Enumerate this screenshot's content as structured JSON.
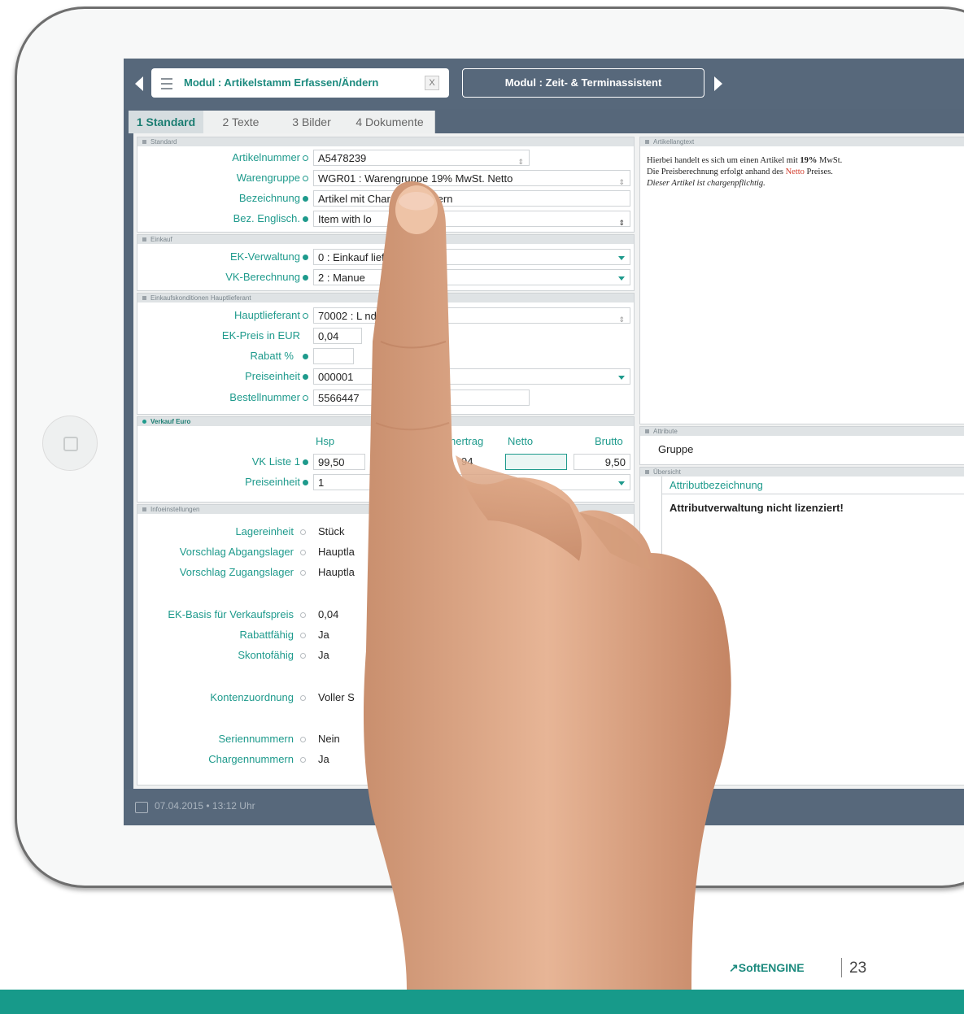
{
  "window": {
    "active_tab": "Modul : Artikelstamm Erfassen/Ändern",
    "close_symbol": "X",
    "inactive_tab": "Modul : Zeit- & Terminassistent"
  },
  "subtabs": [
    {
      "num": "1",
      "label": "Standard"
    },
    {
      "num": "2",
      "label": "Texte"
    },
    {
      "num": "3",
      "label": "Bilder"
    },
    {
      "num": "4",
      "label": "Dokumente"
    }
  ],
  "sections": {
    "standard": "Standard",
    "einkauf": "Einkauf",
    "einkaufskonditionen": "Einkaufskonditionen Hauptlieferant",
    "verkauf": "Verkauf Euro",
    "infoeinstellungen": "Infoeinstellungen",
    "artikelangtext": "Artikellangtext",
    "attribute": "Attribute",
    "uebersicht": "Übersicht"
  },
  "standard": {
    "artikelnummer_label": "Artikelnummer",
    "artikelnummer": "A5478239",
    "warengruppe_label": "Warengruppe",
    "warengruppe": "WGR01   : Warengruppe 19% MwSt. Netto",
    "bezeichnung_label": "Bezeichnung",
    "bezeichnung": "Artikel mit Chargennummern",
    "bez_englisch_label": "Bez. Englisch.",
    "bez_englisch": "Item with lo"
  },
  "einkauf": {
    "ek_verwaltung_label": "EK-Verwaltung",
    "ek_verwaltung": "0 : Einkauf                    lieferant",
    "vk_berechnung_label": "VK-Berechnung",
    "vk_berechnung": "2 : Manue"
  },
  "konditionen": {
    "hauptlieferant_label": "Hauptlieferant",
    "hauptlieferant": "70002 : L                   nd",
    "ek_preis_label": "EK-Preis in EUR",
    "ek_preis": "0,04",
    "rabatt_label": "Rabatt %",
    "rabatt": "",
    "preiseinheit_label": "Preiseinheit",
    "preiseinheit": "000001",
    "bestellnummer_label": "Bestellnummer",
    "bestellnummer": "5566447"
  },
  "verkauf": {
    "col_hsp": "Hsp",
    "col_rohertrag": "hertrag",
    "col_netto": "Netto",
    "col_brutto": "Brutto",
    "vk_liste_label": "VK Liste 1",
    "vk_hsp": "99,50",
    "vk_rohertrag": "94",
    "vk_brutto": "9,50",
    "preiseinheit_label": "Preiseinheit",
    "preiseinheit": "1"
  },
  "info": {
    "lagereinheit_label": "Lagereinheit",
    "lagereinheit": "Stück",
    "abgangslager_label": "Vorschlag Abgangslager",
    "abgangslager": "Hauptla",
    "zugangslager_label": "Vorschlag Zugangslager",
    "zugangslager": "Hauptla",
    "ek_basis_label": "EK-Basis für Verkaufspreis",
    "ek_basis": "0,04",
    "rabattfaehig_label": "Rabattfähig",
    "rabattfaehig": "Ja",
    "skontofaehig_label": "Skontofähig",
    "skontofaehig": "Ja",
    "kontenzuordnung_label": "Kontenzuordnung",
    "kontenzuordnung": "Voller S",
    "seriennummern_label": "Seriennummern",
    "seriennummern": "Nein",
    "chargennummern_label": "Chargennummern",
    "chargennummern": "Ja"
  },
  "langtext": {
    "line1_a": "Hierbei handelt es sich um einen Artikel mit ",
    "line1_b": "19%",
    "line1_c": " MwSt.",
    "line2_a": "Die Preisberechnung erfolgt anhand des ",
    "line2_red": "Netto",
    "line2_c": " Preises.",
    "line3": "Dieser Artikel ist chargenpflichtig."
  },
  "attribute": {
    "gruppe": "Gruppe",
    "col": "Attributbezeichnung",
    "message": "Attributverwaltung nicht lizenziert!"
  },
  "status": {
    "datetime": "07.04.2015 • 13:12 Uhr"
  },
  "footer": {
    "brand": "↗SoftENGINE",
    "page": "23"
  },
  "colors": {
    "accent": "#1e9a8c",
    "header": "#57687b",
    "footer_band": "#179a8a"
  }
}
